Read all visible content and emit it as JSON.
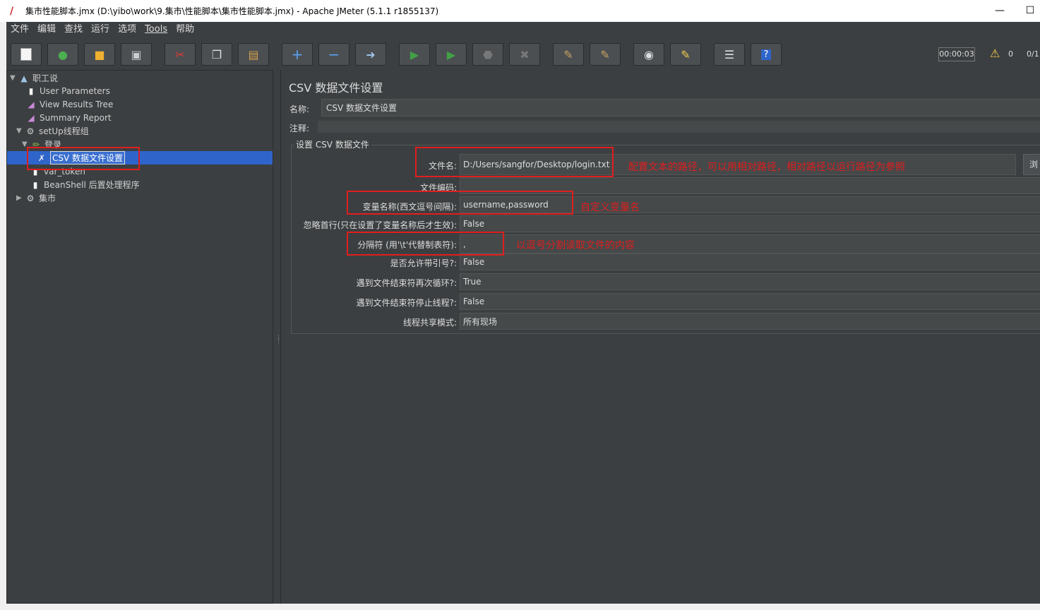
{
  "window": {
    "title": "集市性能脚本.jmx (D:\\yibo\\work\\9.集市\\性能脚本\\集市性能脚本.jmx) - Apache JMeter (5.1.1 r1855137)",
    "minimize": "—",
    "maximize": "☐"
  },
  "menu": [
    "文件",
    "编辑",
    "查找",
    "运行",
    "选项",
    "Tools",
    "帮助"
  ],
  "toolbar": {
    "timer": "00:00:03",
    "warning_count": "0",
    "thread_count": "0/1"
  },
  "tree": {
    "nodes": [
      {
        "label": "职工说",
        "icon": "testplan-icon"
      },
      {
        "label": "User Parameters",
        "icon": "config-icon"
      },
      {
        "label": "View Results Tree",
        "icon": "listener-icon"
      },
      {
        "label": "Summary Report",
        "icon": "listener-icon"
      },
      {
        "label": "setUp线程组",
        "icon": "gear-icon"
      },
      {
        "label": "登录",
        "icon": "sampler-icon"
      },
      {
        "label": "CSV 数据文件设置",
        "icon": "csv-config-icon"
      },
      {
        "label": "var_token",
        "icon": "extractor-icon"
      },
      {
        "label": "BeanShell 后置处理程序",
        "icon": "postprocessor-icon"
      },
      {
        "label": "集市",
        "icon": "gear-icon"
      }
    ]
  },
  "panel": {
    "title": "CSV 数据文件设置",
    "name_label": "名称:",
    "name_value": "CSV 数据文件设置",
    "comment_label": "注释:",
    "comment_value": "",
    "group_title": "设置 CSV 数据文件",
    "browse_label": "浏",
    "props": [
      {
        "label": "文件名:",
        "value": "D:/Users/sangfor/Desktop/login.txt"
      },
      {
        "label": "文件编码:",
        "value": ""
      },
      {
        "label": "变量名称(西文逗号间隔):",
        "value": "username,password"
      },
      {
        "label": "忽略首行(只在设置了变量名称后才生效):",
        "value": "False"
      },
      {
        "label": "分隔符 (用'\\t'代替制表符):",
        "value": ","
      },
      {
        "label": "是否允许带引号?:",
        "value": "False"
      },
      {
        "label": "遇到文件结束符再次循环?:",
        "value": "True"
      },
      {
        "label": "遇到文件结束符停止线程?:",
        "value": "False"
      },
      {
        "label": "线程共享模式:",
        "value": "所有现场"
      }
    ]
  },
  "annotations": {
    "filename_note": "配置文本的路径，可以用相对路径，相对路径以运行路径为参照",
    "varname_note": "自定义变量名",
    "delimiter_note": "以逗号分割读取文件的内容"
  },
  "colors": {
    "background": "#3c3f41",
    "selection": "#2f65ca",
    "annotation_red": "#e01e1e"
  }
}
